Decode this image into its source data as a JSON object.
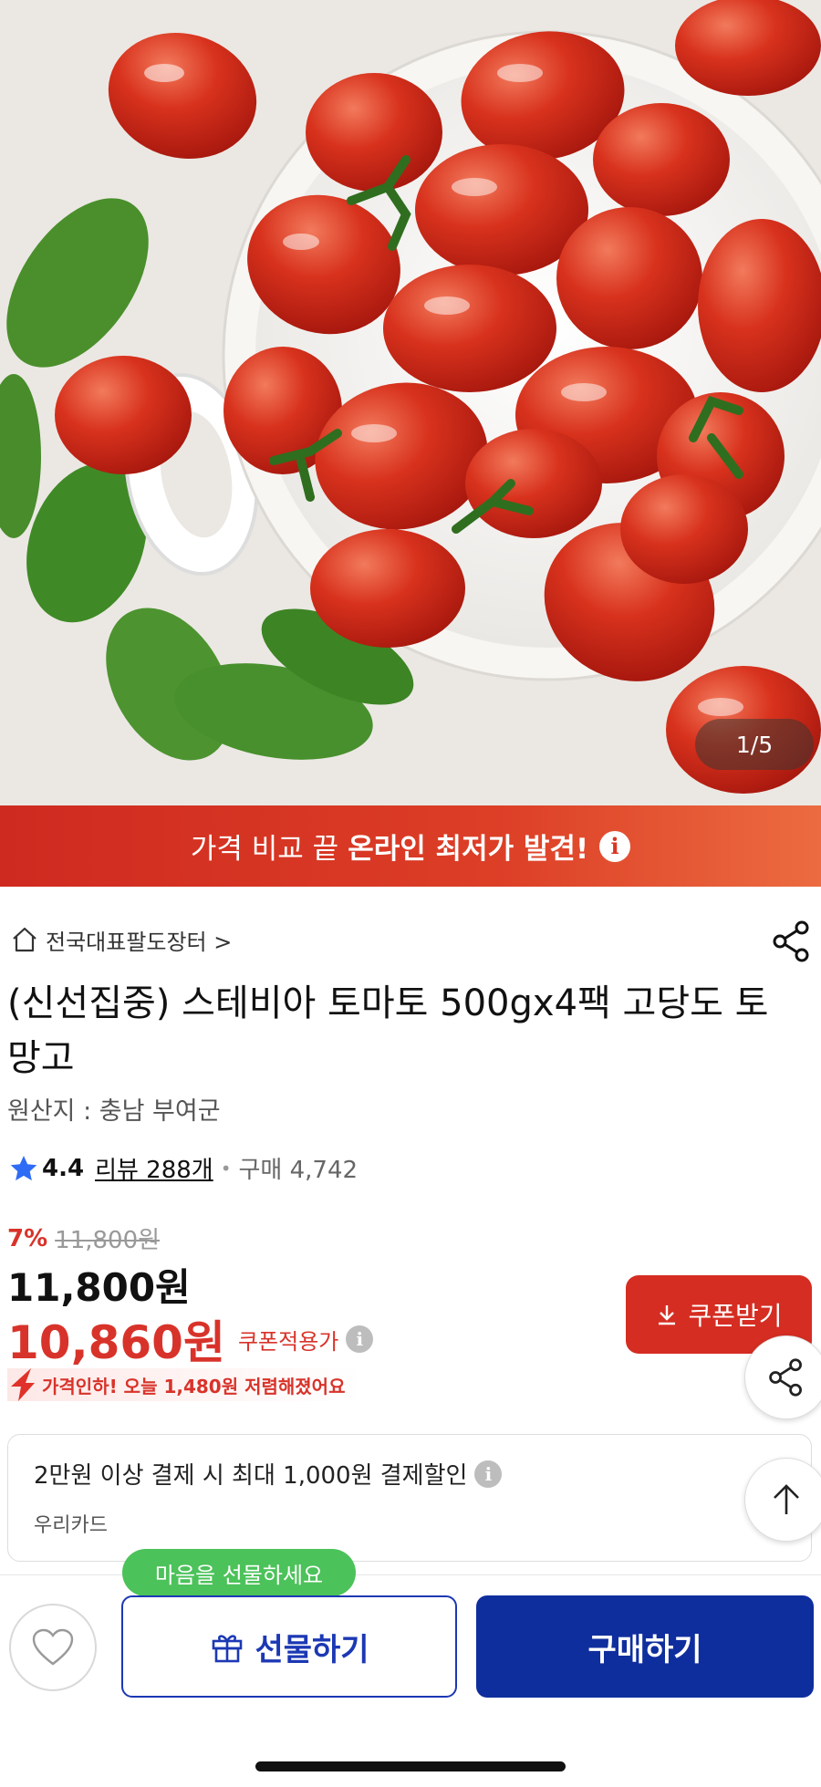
{
  "gallery": {
    "page_indicator": "1/5"
  },
  "promo_banner": {
    "text": "가격 비교 끝",
    "bold_text": "온라인 최저가 발견!",
    "icon": "info-icon"
  },
  "product": {
    "store_name": "전국대표팔도장터 >",
    "title": "(신선집중) 스테비아 토마토 500gx4팩  고당도 토망고",
    "origin": "원산지 : 충남 부여군",
    "rating": "4.4",
    "review_count": "리뷰 288개",
    "purchase_count": "구매 4,742",
    "discount_rate": "7%",
    "original_price": "11,800원",
    "price": "11,800원",
    "coupon_price": "10,860원",
    "coupon_price_label": "쿠폰적용가",
    "coupon_button_label": "쿠폰받기",
    "price_drop_text": "가격인하! 오늘 1,480원 저렴해졌어요"
  },
  "card_discount": {
    "text": "2만원 이상 결제 시 최대 1,000원 결제할인",
    "card_name": "우리카드"
  },
  "bottom_bar": {
    "gift_tooltip": "마음을 선물하세요",
    "gift_button": "선물하기",
    "buy_button": "구매하기"
  },
  "colors": {
    "accent_red": "#d52d22",
    "primary_blue": "#0f2e9e",
    "tooltip_green": "#4cc25a"
  }
}
